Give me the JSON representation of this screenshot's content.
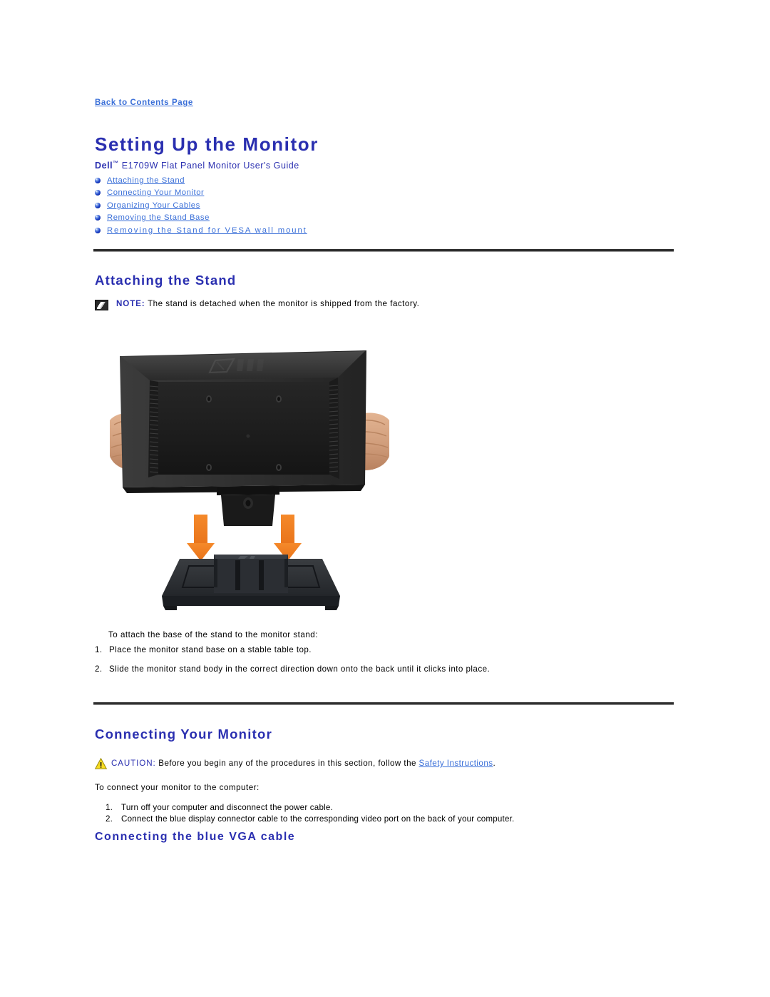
{
  "document": {
    "back_link": "Back to Contents Page",
    "title": "Setting Up the Monitor",
    "subtitle_brand": "Dell",
    "subtitle_tm": "™",
    "subtitle_rest": " E1709W Flat Panel Monitor User's Guide"
  },
  "toc": {
    "items": [
      {
        "label": "Attaching the Stand"
      },
      {
        "label": "Connecting Your Monitor"
      },
      {
        "label": "Organizing Your Cables"
      },
      {
        "label": "Removing the Stand Base "
      },
      {
        "label": "Removing the Stand for VESA wall mount"
      }
    ]
  },
  "attaching_section": {
    "heading": "Attaching the Stand",
    "note_label": "NOTE:",
    "note_text": " The stand is detached when the monitor is shipped from the factory.",
    "figure_alt": "Monitor back panel held by two hands above the stand base with orange downward arrows",
    "intro": "To attach the base of the stand to the monitor stand:",
    "steps": [
      {
        "num": "1.",
        "text": "Place the monitor stand base on a stable table top."
      },
      {
        "num": "2.",
        "text": "Slide the monitor stand body in the correct direction down onto the back until it clicks into place."
      }
    ]
  },
  "connecting_section": {
    "heading": "Connecting Your Monitor",
    "caution_label": "CAUTION:",
    "caution_text_before": " Before you begin any of the procedures in this section, follow the ",
    "caution_link": "Safety Instructions",
    "caution_text_after": ".",
    "intro": "To connect your monitor to the computer:",
    "steps": [
      {
        "num": "1.",
        "text": "Turn off your computer and disconnect the power cable."
      },
      {
        "num": "2.",
        "text": "Connect the blue display connector cable to the corresponding video port on the back of your computer."
      }
    ],
    "subheading": "Connecting the blue VGA cable"
  },
  "colors": {
    "heading_blue": "#2a2fb0",
    "link_blue": "#3a6fd8",
    "rule_dark": "#2e2e2e",
    "arrow_orange": "#ef7c1f",
    "caution_yellow": "#f5d400"
  }
}
